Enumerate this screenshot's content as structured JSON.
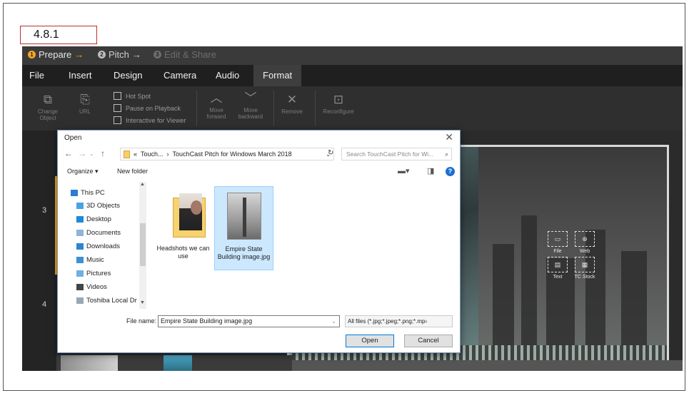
{
  "step_label": "4.8.1",
  "stepbar": {
    "steps": [
      {
        "num": "1",
        "label": "Prepare",
        "arrow": "→"
      },
      {
        "num": "2",
        "label": "Pitch",
        "arrow": "→"
      },
      {
        "num": "3",
        "label": "Edit & Share"
      }
    ]
  },
  "menu": [
    "File",
    "Insert",
    "Design",
    "Camera",
    "Audio",
    "Format"
  ],
  "ribbon": {
    "change_object": [
      "Change",
      "Object"
    ],
    "url": "URL",
    "checks": [
      "Hot Spot",
      "Pause on Playback",
      "Interactive for Viewer"
    ],
    "move_forward": [
      "Move",
      "forward"
    ],
    "move_backward": [
      "Move",
      "backward"
    ],
    "remove": "Remove",
    "reconfigure": "Reconfigure"
  },
  "slides": [
    "3",
    "4"
  ],
  "stage_picks": [
    "File",
    "Web",
    "Text",
    "TC Stock"
  ],
  "dialog": {
    "title": "Open",
    "close": "✕",
    "breadcrumb": [
      "«",
      "Touch...",
      "›",
      "TouchCast Pitch for Windows March 2018"
    ],
    "search_placeholder": "Search TouchCast Pitch for Wi...",
    "organize": "Organize ▾",
    "new_folder": "New folder",
    "nav_items": [
      "This PC",
      "3D Objects",
      "Desktop",
      "Documents",
      "Downloads",
      "Music",
      "Pictures",
      "Videos",
      "Toshiba Local Dr"
    ],
    "files": [
      {
        "name": "Headshots we can use",
        "selected": false
      },
      {
        "name": "Empire State Building image.jpg",
        "selected": true
      }
    ],
    "file_name_label": "File name:",
    "file_name_value": "Empire State Building image.jpg",
    "file_type": "All files (*.jpg;*.jpeg;*.png;*.mp›",
    "open_btn": "Open",
    "cancel_btn": "Cancel"
  },
  "colors": {
    "accent": "#f5a623",
    "dialog_primary": "#0078d7",
    "selected": "#cce8ff"
  }
}
